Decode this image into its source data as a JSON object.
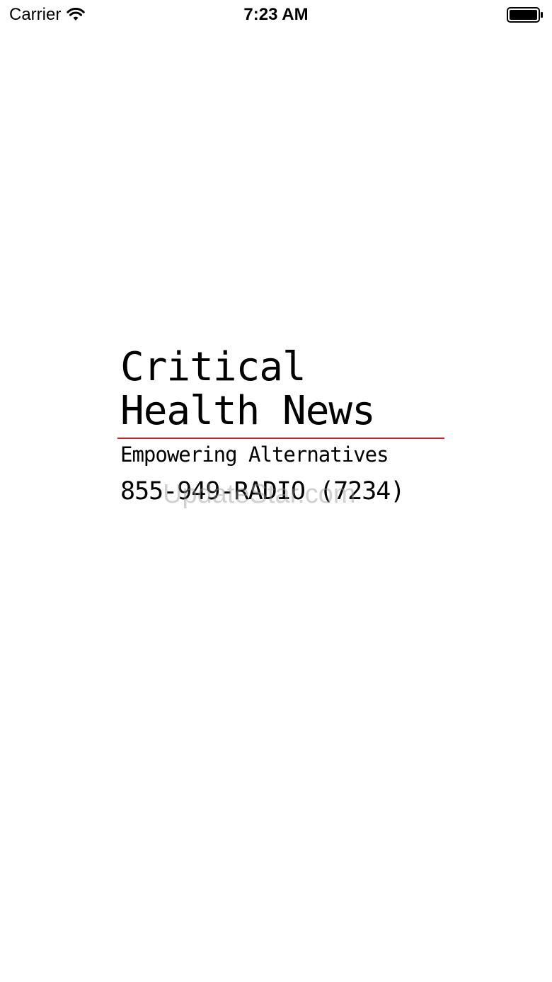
{
  "status_bar": {
    "carrier": "Carrier",
    "time": "7:23 AM",
    "wifi_icon": "wifi-icon",
    "battery_icon": "battery-icon"
  },
  "logo": {
    "title_line1": "Critical",
    "title_line2": "Health News",
    "tagline": "Empowering Alternatives",
    "phone": "855-949-RADIO (7234)",
    "rule_color": "#d11f1f"
  },
  "watermark": "UpdateStar.com"
}
